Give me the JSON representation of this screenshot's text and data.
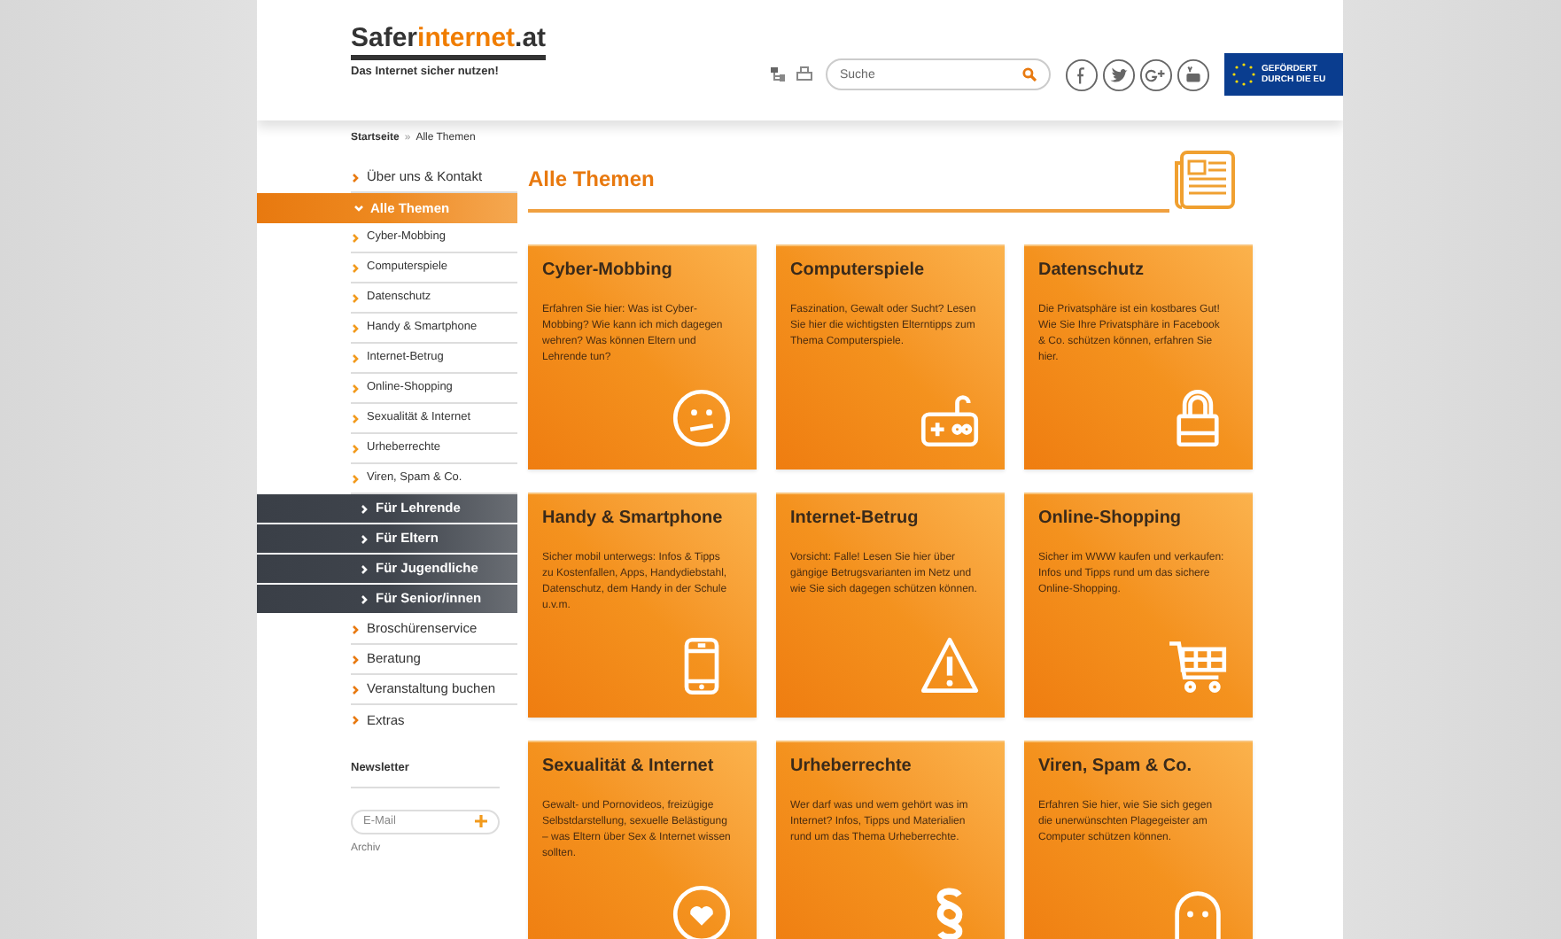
{
  "header": {
    "logo": {
      "part_1": "Safer",
      "part_2": "internet",
      "part_3": ".at"
    },
    "tagline": "Das Internet sicher nutzen!",
    "search": {
      "placeholder": "Suche"
    },
    "eu_badge": "GEFÖRDERT DURCH DIE EU"
  },
  "breadcrumb": [
    "Startseite",
    "»",
    "Alle Themen"
  ],
  "sidebar": {
    "items": [
      {
        "label": "Über uns & Kontakt",
        "kind": "main",
        "selected": false
      },
      {
        "label": "Alle Themen",
        "kind": "main",
        "selected": true
      },
      {
        "label": "Cyber-Mobbing",
        "kind": "sub",
        "selected": false
      },
      {
        "label": "Computerspiele",
        "kind": "sub",
        "selected": false
      },
      {
        "label": "Datenschutz",
        "kind": "sub",
        "selected": false
      },
      {
        "label": "Handy & Smartphone",
        "kind": "sub",
        "selected": false
      },
      {
        "label": "Internet-Betrug",
        "kind": "sub",
        "selected": false
      },
      {
        "label": "Online-Shopping",
        "kind": "sub",
        "selected": false
      },
      {
        "label": "Sexualität & Internet",
        "kind": "sub",
        "selected": false
      },
      {
        "label": "Urheberrechte",
        "kind": "sub",
        "selected": false
      },
      {
        "label": "Viren, Spam & Co.",
        "kind": "sub",
        "selected": false
      },
      {
        "label": "Für Lehrende",
        "kind": "audience",
        "selected": false
      },
      {
        "label": "Für Eltern",
        "kind": "audience",
        "selected": false
      },
      {
        "label": "Für Jugendliche",
        "kind": "audience",
        "selected": false
      },
      {
        "label": "Für Senior/innen",
        "kind": "audience",
        "selected": false
      },
      {
        "label": "Broschürenservice",
        "kind": "main",
        "selected": false
      },
      {
        "label": "Beratung",
        "kind": "main",
        "selected": false
      },
      {
        "label": "Veranstaltung buchen",
        "kind": "main",
        "selected": false
      },
      {
        "label": "Extras",
        "kind": "main",
        "selected": false
      }
    ],
    "newsletter": {
      "heading": "Newsletter",
      "email": {
        "placeholder": "E-Mail"
      },
      "archive_link": "Archiv"
    }
  },
  "content": {
    "title": "Alle Themen",
    "cards": [
      {
        "title": "Cyber-Mobbing",
        "text": "Erfahren Sie hier: Was ist Cyber-Mobbing? Wie kann ich mich dagegen wehren? Was können Eltern und Lehrende tun?"
      },
      {
        "title": "Computerspiele",
        "text": "Faszination, Gewalt oder Sucht? Lesen Sie hier die wichtigsten Elterntipps zum Thema Computerspiele."
      },
      {
        "title": "Datenschutz",
        "text": "Die Privatsphäre ist ein kostbares Gut! Wie Sie Ihre Privatsphäre in Facebook & Co. schützen können, erfahren Sie hier."
      },
      {
        "title": "Handy & Smartphone",
        "text": "Sicher mobil unterwegs: Infos & Tipps zu Kostenfallen, Apps, Handydiebstahl, Datenschutz, dem Handy in der Schule u.v.m."
      },
      {
        "title": "Internet-Betrug",
        "text": "Vorsicht: Falle! Lesen Sie hier über gängige Betrugsvarianten im Netz und wie Sie sich dagegen schützen können."
      },
      {
        "title": "Online-Shopping",
        "text": "Sicher im WWW kaufen und verkaufen: Infos und Tipps rund um das sichere Online-Shopping."
      },
      {
        "title": "Sexualität & Internet",
        "text": "Gewalt- und Pornovideos, freizügige Selbstdarstellung, sexuelle Belästigung – was Eltern über Sex & Internet wissen sollten."
      },
      {
        "title": "Urheberrechte",
        "text": "Wer darf was und wem gehört was im Internet? Infos, Tipps und Materialien rund um das Thema Urheberrechte."
      },
      {
        "title": "Viren, Spam & Co.",
        "text": "Erfahren Sie hier, wie Sie sich gegen die unerwünschten Plagegeister am Computer schützen können."
      }
    ]
  }
}
